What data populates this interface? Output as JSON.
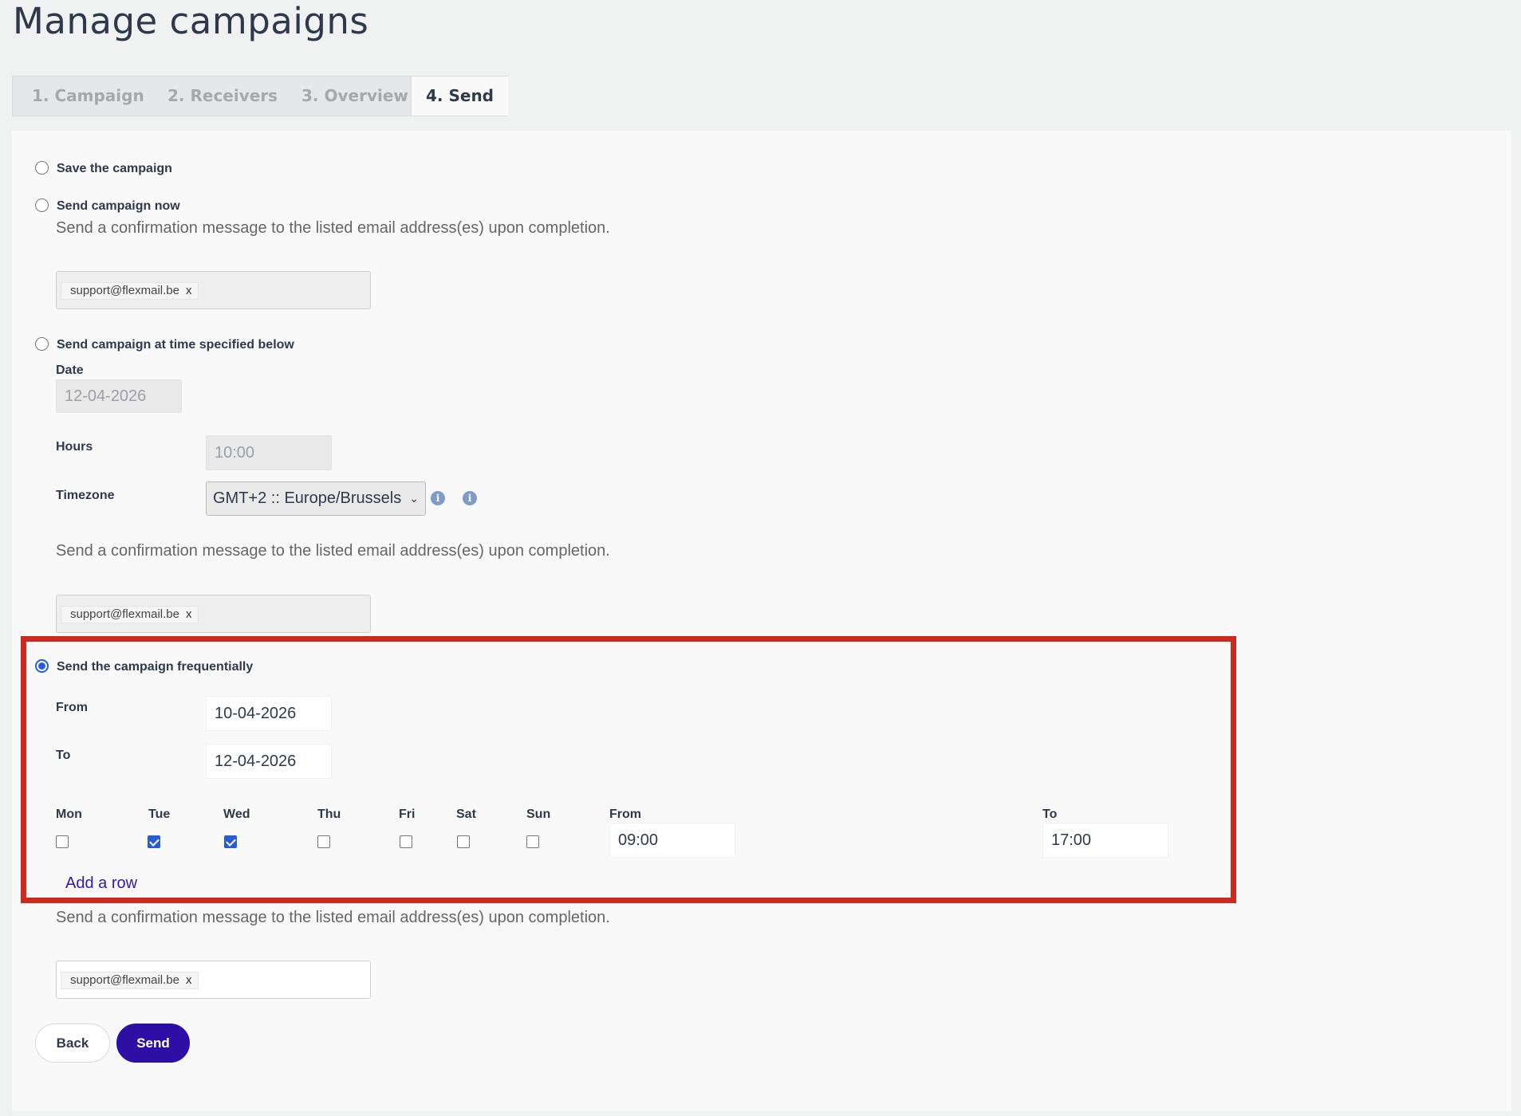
{
  "page": {
    "title": "Manage campaigns"
  },
  "tabs": [
    {
      "label": "1. Campaign",
      "active": false
    },
    {
      "label": "2. Receivers",
      "active": false
    },
    {
      "label": "3. Overview",
      "active": false
    },
    {
      "label": "4. Send",
      "active": true
    }
  ],
  "options": {
    "save": {
      "label": "Save the campaign",
      "selected": false
    },
    "send_now": {
      "label": "Send campaign now",
      "selected": false,
      "help": "Send a confirmation message to the listed email address(es) upon completion.",
      "email_tag": "support@flexmail.be",
      "tag_remove": "x"
    },
    "scheduled": {
      "label": "Send campaign at time specified below",
      "selected": false,
      "date_label": "Date",
      "date_value": "12-04-2026",
      "hours_label": "Hours",
      "hours_value": "10:00",
      "timezone_label": "Timezone",
      "timezone_value": "GMT+2 :: Europe/Brussels",
      "help": "Send a confirmation message to the listed email address(es) upon completion.",
      "email_tag": "support@flexmail.be",
      "tag_remove": "x"
    },
    "frequent": {
      "label": "Send the campaign frequentially",
      "selected": true,
      "from_label": "From",
      "from_value": "10-04-2026",
      "to_label": "To",
      "to_value": "12-04-2026",
      "days": [
        {
          "label": "Mon",
          "checked": false
        },
        {
          "label": "Tue",
          "checked": true
        },
        {
          "label": "Wed",
          "checked": true
        },
        {
          "label": "Thu",
          "checked": false
        },
        {
          "label": "Fri",
          "checked": false
        },
        {
          "label": "Sat",
          "checked": false
        },
        {
          "label": "Sun",
          "checked": false
        }
      ],
      "time_from_label": "From",
      "time_from_value": "09:00",
      "time_to_label": "To",
      "time_to_value": "17:00",
      "add_row": "Add a row",
      "help": "Send a confirmation message to the listed email address(es) upon completion.",
      "email_tag": "support@flexmail.be",
      "tag_remove": "x"
    }
  },
  "buttons": {
    "back": "Back",
    "send": "Send"
  },
  "colors": {
    "accent": "#2d0fa6",
    "highlight": "#cc2a1e",
    "checkbox": "#2a5bd7"
  }
}
